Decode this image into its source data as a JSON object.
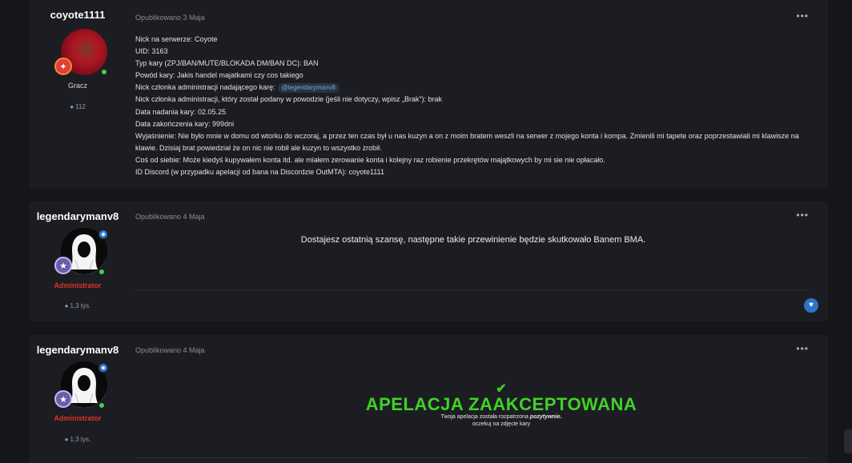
{
  "posts": [
    {
      "author": "coyote1111",
      "role": "Gracz",
      "post_count": "112",
      "meta": "Opublikowano 3 Maja",
      "lines": {
        "nick": "Nick na serwerze: Coyote",
        "uid": "UID: 3163",
        "type": "Typ kary (ZPJ/BAN/MUTE/BLOKADA DM/BAN DC): BAN",
        "reason": "Powód kary: Jakis handel majatkami czy cos takiego",
        "admin_label": "Nick członka administracji nadającego karę:",
        "admin_mention": "@legendarymanv8",
        "reporter": "Nick członka administracji, który został podany w powodzie (jeśli nie dotyczy, wpisz „Brak”): brak",
        "date_given": "Data nadania kary: 02.05.25",
        "date_end": "Data zakończenia kary: 999dni",
        "explanation": "Wyjaśnienie: Nie było mnie w domu od wtorku do wczoraj, a przez ten czas był u nas kuzyn a on z moim bratem weszli na serwer z mojego konta i kompa. Zmienili mi tapete oraz poprzestawiali mi klawisze na klawie. Dzisiaj brat powiedział że on nic nie robił ale kuzyn to wszystko zrobił.",
        "about": "Coś od siebie: Może kiedyś kupywałem konta itd. ale miałem zerowanie konta i kolejny raz robienie przekrętów majątkowych by mi sie nie opłacało.",
        "discord": "ID Discord (w przypadku apelacji od bana na Discordzie OutMTA): coyote1111"
      }
    },
    {
      "author": "legendarymanv8",
      "role": "Administrator",
      "post_count": "1,3 tys.",
      "meta": "Opublikowano 4 Maja",
      "text": "Dostajesz ostatnią szansę, następne takie przewinienie będzie skutkowało Banem BMA."
    },
    {
      "author": "legendarymanv8",
      "role": "Administrator",
      "post_count": "1,3 tys.",
      "meta": "Opublikowano 4 Maja",
      "banner_title": "APELACJA ZAAKCEPTOWANA",
      "banner_sub_prefix": "Twoja apelacja została rozpatrzona",
      "banner_sub_emph": "pozytywnie.",
      "banner_sub_line2": "oczekuj na zdjęcie kary"
    }
  ],
  "ui": {
    "more_glyph": "•••",
    "heart_glyph": "♥",
    "check_glyph": "✔",
    "bubble_glyph": "●"
  },
  "colors": {
    "accent_blue": "#2b73c9",
    "admin_red": "#e0312b",
    "accepted_green": "#3fd326"
  }
}
